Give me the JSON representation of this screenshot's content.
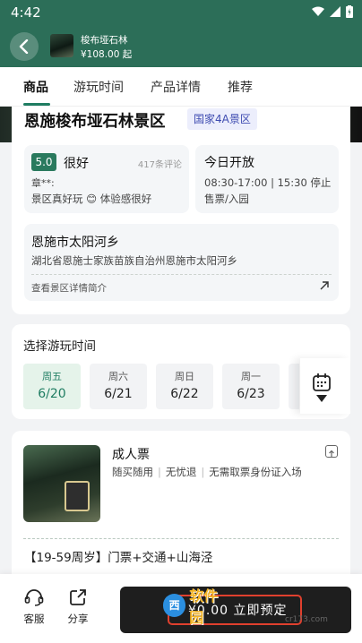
{
  "status_bar": {
    "time": "4:42"
  },
  "header": {
    "title": "梭布垭石林",
    "price": "¥108.00 起"
  },
  "tabs": [
    {
      "label": "商品",
      "active": true
    },
    {
      "label": "游玩时间",
      "active": false
    },
    {
      "label": "产品详情",
      "active": false
    },
    {
      "label": "推荐",
      "active": false
    }
  ],
  "attraction": {
    "name": "恩施梭布垭石林景区",
    "tag": "国家4A景区",
    "rating": {
      "score": "5.0",
      "word": "很好",
      "count": "417条评论",
      "reviewer": "章**:",
      "excerpt": "景区真好玩 😊 体验感很好"
    },
    "opening": {
      "title": "今日开放",
      "hours": "08:30-17:00 | 15:30 停止售票/入园"
    },
    "address": {
      "city": "恩施市太阳河乡",
      "full": "湖北省恩施士家族苗族自治州恩施市太阳河乡",
      "link": "查看景区详情简介"
    }
  },
  "date_picker": {
    "heading": "选择游玩时间",
    "dates": [
      {
        "day": "周五",
        "date": "6/20",
        "selected": true
      },
      {
        "day": "周六",
        "date": "6/21",
        "selected": false
      },
      {
        "day": "周日",
        "date": "6/22",
        "selected": false
      },
      {
        "day": "周一",
        "date": "6/23",
        "selected": false
      }
    ]
  },
  "ticket": {
    "name": "成人票",
    "features": [
      "随买随用",
      "无忧退",
      "无需取票身份证入场"
    ],
    "offer": "【19-59周岁】门票+交通+山海泾"
  },
  "bottom_bar": {
    "service_label": "客服",
    "share_label": "分享",
    "book_label": "¥0.00  立即预定"
  },
  "watermark": {
    "logo_text": "西",
    "text": "软件园",
    "url": "cr173.com"
  },
  "colors": {
    "header_green": "#2c6e58",
    "accent_green": "#1f7d62",
    "tag_blue": "#3d4bb0",
    "highlight_red": "#e0402e"
  }
}
